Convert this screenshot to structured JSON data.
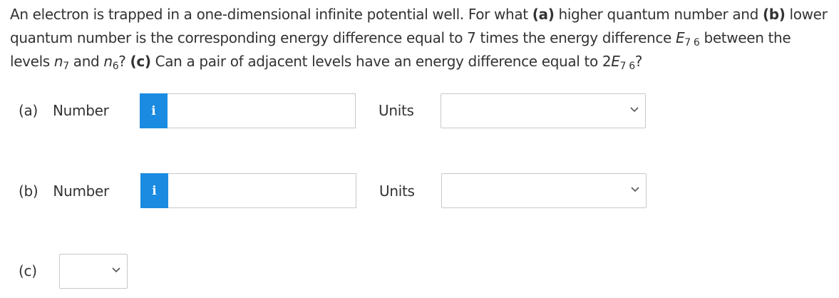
{
  "question": {
    "t1": "An electron is trapped in a one-dimensional infinite potential well. For what ",
    "a_tag": "(a)",
    "t2": " higher quantum number and ",
    "b_tag": "(b)",
    "t3": " lower quantum number is the corresponding energy difference equal to 7 times the energy difference ",
    "E": "E",
    "E_sub": "7 6",
    "t4": " between the levels ",
    "n1": "n",
    "n1_sub": "7",
    "t5": " and ",
    "n2": "n",
    "n2_sub": "6",
    "t6": "? ",
    "c_tag": "(c)",
    "t7": " Can a pair of adjacent levels have an energy difference equal to 2",
    "E2": "E",
    "E2_sub": "7 6",
    "t8": "?"
  },
  "part_a": {
    "tag": "(a)",
    "label": "Number",
    "info_icon": "i",
    "value": "",
    "units_label": "Units",
    "units_selected": ""
  },
  "part_b": {
    "tag": "(b)",
    "label": "Number",
    "info_icon": "i",
    "value": "",
    "units_label": "Units",
    "units_selected": ""
  },
  "part_c": {
    "tag": "(c)",
    "selected": ""
  },
  "colors": {
    "info_button": "#1a8be0",
    "border": "#c8c8c8",
    "text": "#333333"
  }
}
